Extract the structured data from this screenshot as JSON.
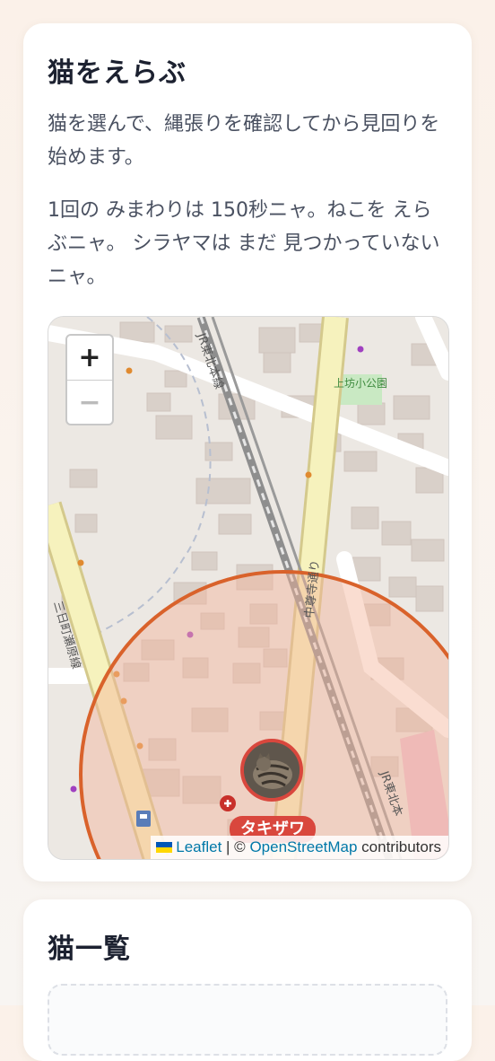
{
  "colors": {
    "accent": "#d9473d",
    "territory_stroke": "#d9622b",
    "territory_fill": "#f3b39a"
  },
  "card_select": {
    "title": "猫をえらぶ",
    "description": "猫を選んで、縄張りを確認してから見回りを始めます。",
    "hint": "1回の みまわりは 150秒ニャ。ねこを えらぶニャ。 シラヤマは まだ 見つかっていないニャ。"
  },
  "map": {
    "zoom_in_label": "+",
    "zoom_out_label": "−",
    "labels": {
      "rail_top": "JR東北本線",
      "rail_bottom": "JR東北本",
      "road_left": "三日町瀬原線",
      "road_center": "中尊寺通り",
      "park": "上坊小公園"
    },
    "marker_label": "タキザワ",
    "attribution": {
      "leaflet": "Leaflet",
      "separator": " | © ",
      "osm": "OpenStreetMap",
      "suffix": " contributors"
    }
  },
  "card_list": {
    "title": "猫一覧"
  }
}
